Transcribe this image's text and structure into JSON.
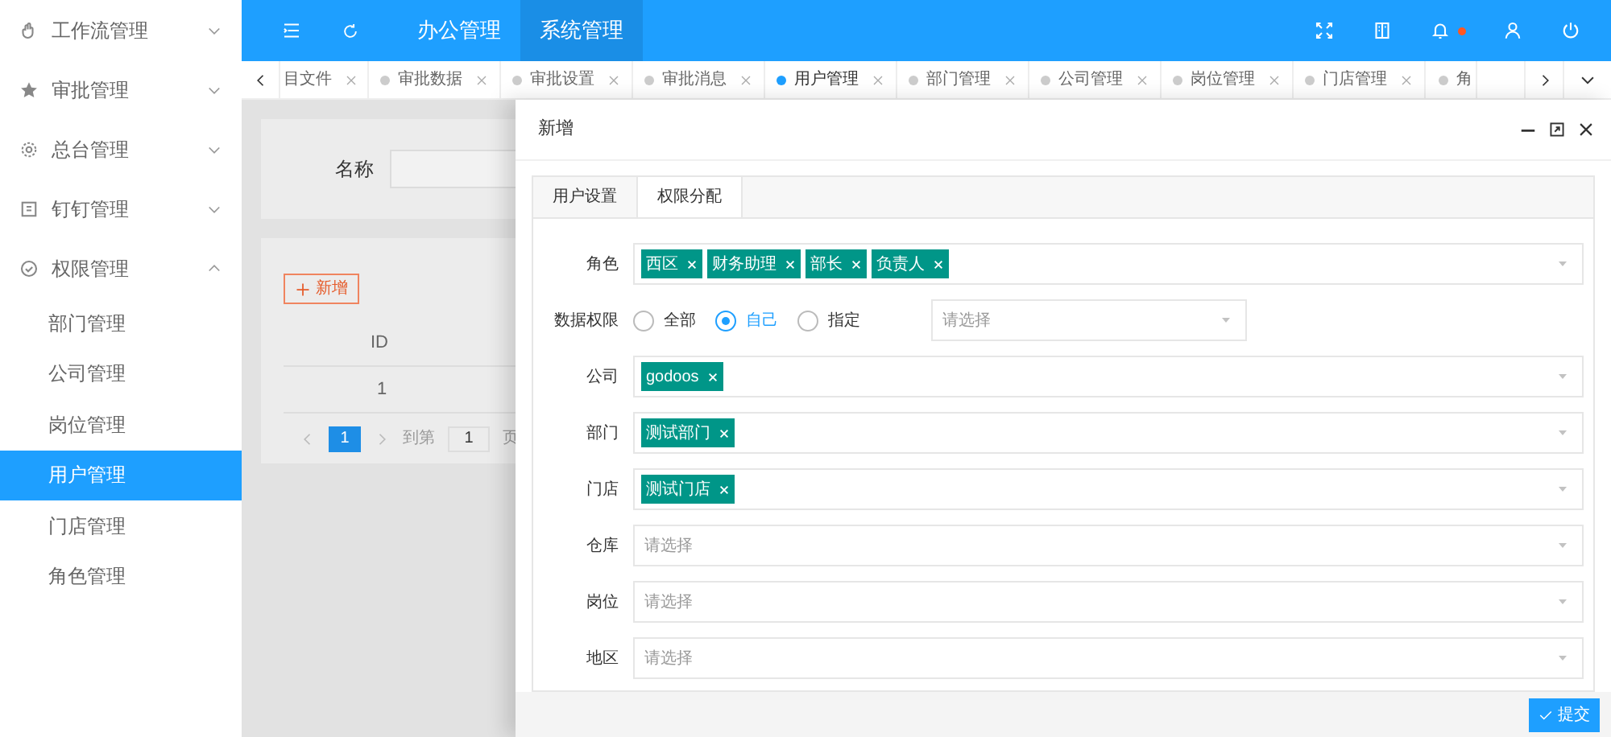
{
  "sidebar": {
    "items": [
      {
        "label": "工作流管理",
        "expanded": false
      },
      {
        "label": "审批管理",
        "expanded": false
      },
      {
        "label": "总台管理",
        "expanded": false
      },
      {
        "label": "钉钉管理",
        "expanded": false
      },
      {
        "label": "权限管理",
        "expanded": true,
        "children": [
          {
            "label": "部门管理",
            "selected": false
          },
          {
            "label": "公司管理",
            "selected": false
          },
          {
            "label": "岗位管理",
            "selected": false
          },
          {
            "label": "用户管理",
            "selected": true
          },
          {
            "label": "门店管理",
            "selected": false
          },
          {
            "label": "角色管理",
            "selected": false
          }
        ]
      }
    ]
  },
  "top_bar": {
    "menus": [
      {
        "label": "办公管理",
        "selected": false
      },
      {
        "label": "系统管理",
        "selected": true
      }
    ],
    "notification_dot": true
  },
  "tabs": [
    {
      "label": "目文件",
      "selected": false
    },
    {
      "label": "审批数据",
      "selected": false
    },
    {
      "label": "审批设置",
      "selected": false
    },
    {
      "label": "审批消息",
      "selected": false
    },
    {
      "label": "用户管理",
      "selected": true
    },
    {
      "label": "部门管理",
      "selected": false
    },
    {
      "label": "公司管理",
      "selected": false
    },
    {
      "label": "岗位管理",
      "selected": false
    },
    {
      "label": "门店管理",
      "selected": false
    },
    {
      "label": "角",
      "selected": false
    }
  ],
  "search_card": {
    "label": "名称"
  },
  "list_card": {
    "add_button": "新增",
    "table": {
      "columns": [
        "ID"
      ],
      "rows": [
        [
          "1"
        ]
      ]
    },
    "pagination": {
      "pages": [
        {
          "label": "1",
          "selected": true
        }
      ],
      "goto_label": "到第",
      "goto_value": "1",
      "page_unit": "页"
    }
  },
  "drawer": {
    "title": "新增",
    "tabs": [
      {
        "label": "用户设置",
        "selected": false
      },
      {
        "label": "权限分配",
        "selected": true
      }
    ],
    "rows": [
      {
        "kind": "tags",
        "label": "角色",
        "tags": [
          "西区",
          "财务助理",
          "部长",
          "负责人"
        ]
      },
      {
        "kind": "radio",
        "label": "数据权限",
        "options": [
          {
            "label": "全部",
            "selected": false
          },
          {
            "label": "自己",
            "selected": true
          },
          {
            "label": "指定",
            "selected": false
          }
        ],
        "placeholder": "请选择"
      },
      {
        "kind": "tags",
        "label": "公司",
        "tags": [
          "godoos"
        ]
      },
      {
        "kind": "tags",
        "label": "部门",
        "tags": [
          "测试部门"
        ]
      },
      {
        "kind": "tags",
        "label": "门店",
        "tags": [
          "测试门店"
        ]
      },
      {
        "kind": "select",
        "label": "仓库",
        "placeholder": "请选择"
      },
      {
        "kind": "select",
        "label": "岗位",
        "placeholder": "请选择"
      },
      {
        "kind": "select",
        "label": "地区",
        "placeholder": "请选择"
      }
    ],
    "submit_button": "提交"
  }
}
